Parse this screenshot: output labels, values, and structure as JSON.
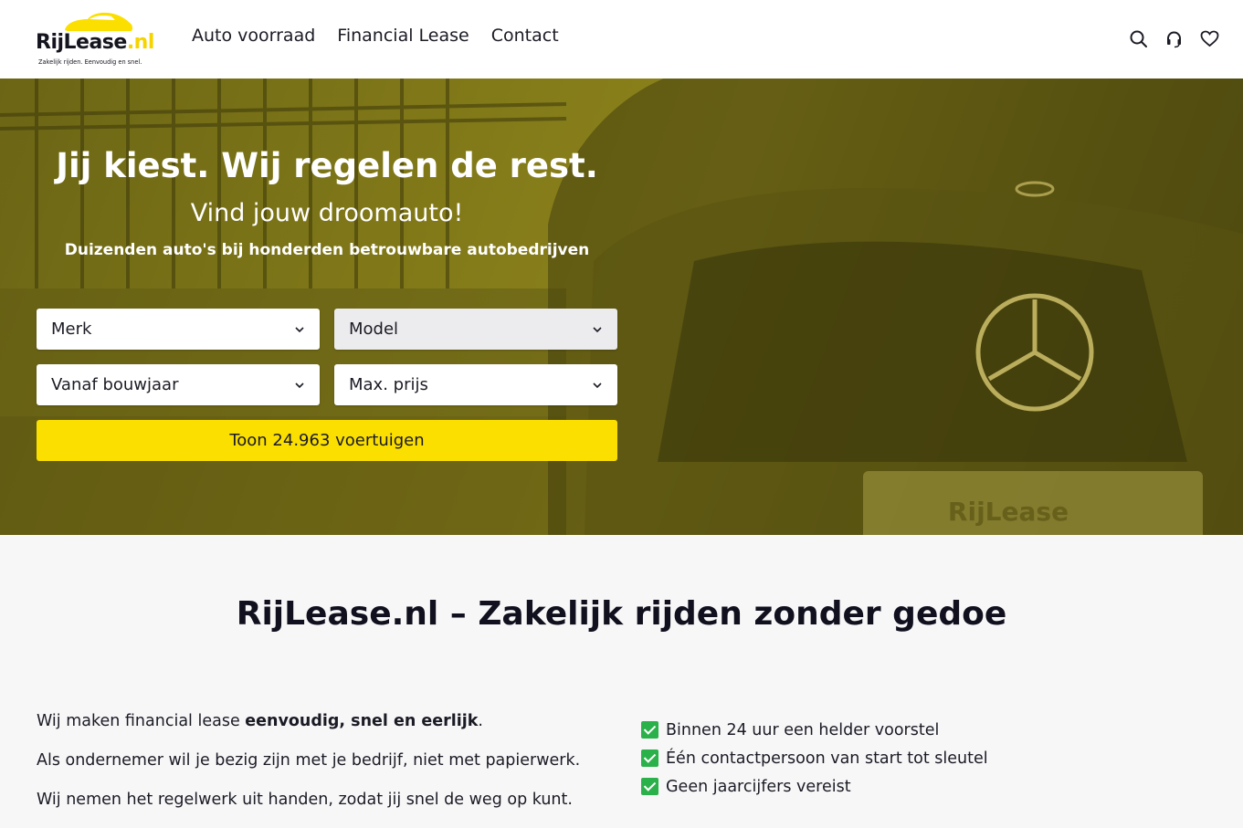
{
  "header": {
    "logo": {
      "name": "RijLease",
      "tld": ".nl",
      "tagline": "Zakelijk rijden. Eenvoudig en snel."
    },
    "nav": [
      "Auto voorraad",
      "Financial Lease",
      "Contact"
    ],
    "icons": [
      "search-icon",
      "headset-icon",
      "heart-icon"
    ]
  },
  "hero": {
    "title": "Jij kiest. Wij regelen de rest.",
    "subtitle": "Vind jouw droomauto!",
    "description": "Duizenden auto's bij honderden betrouwbare autobedrijven",
    "plate_text": "RijLease",
    "filters": {
      "brand": "Merk",
      "model": "Model",
      "year": "Vanaf bouwjaar",
      "price": "Max. prijs"
    },
    "cta": "Toon 24.963 voertuigen"
  },
  "intro": {
    "title": "RijLease.nl – Zakelijk rijden zonder gedoe",
    "left": [
      {
        "pre": "Wij maken financial lease ",
        "bold": "eenvoudig, snel en eerlijk",
        "post": "."
      },
      {
        "pre": "Als ondernemer wil je bezig zijn met je bedrijf, niet met papierwerk.",
        "bold": "",
        "post": ""
      },
      {
        "pre": "Wij nemen het regelwerk uit handen, zodat jij snel de weg op kunt.",
        "bold": "",
        "post": ""
      }
    ],
    "right": [
      "Binnen 24 uur een helder voorstel",
      "Één contactpersoon van start tot sleutel",
      "Geen jaarcijfers vereist"
    ]
  },
  "colors": {
    "accent": "#fbdf00",
    "hero_overlay": "#8d831c",
    "text": "#1b1b25",
    "check": "#2bb14a"
  }
}
